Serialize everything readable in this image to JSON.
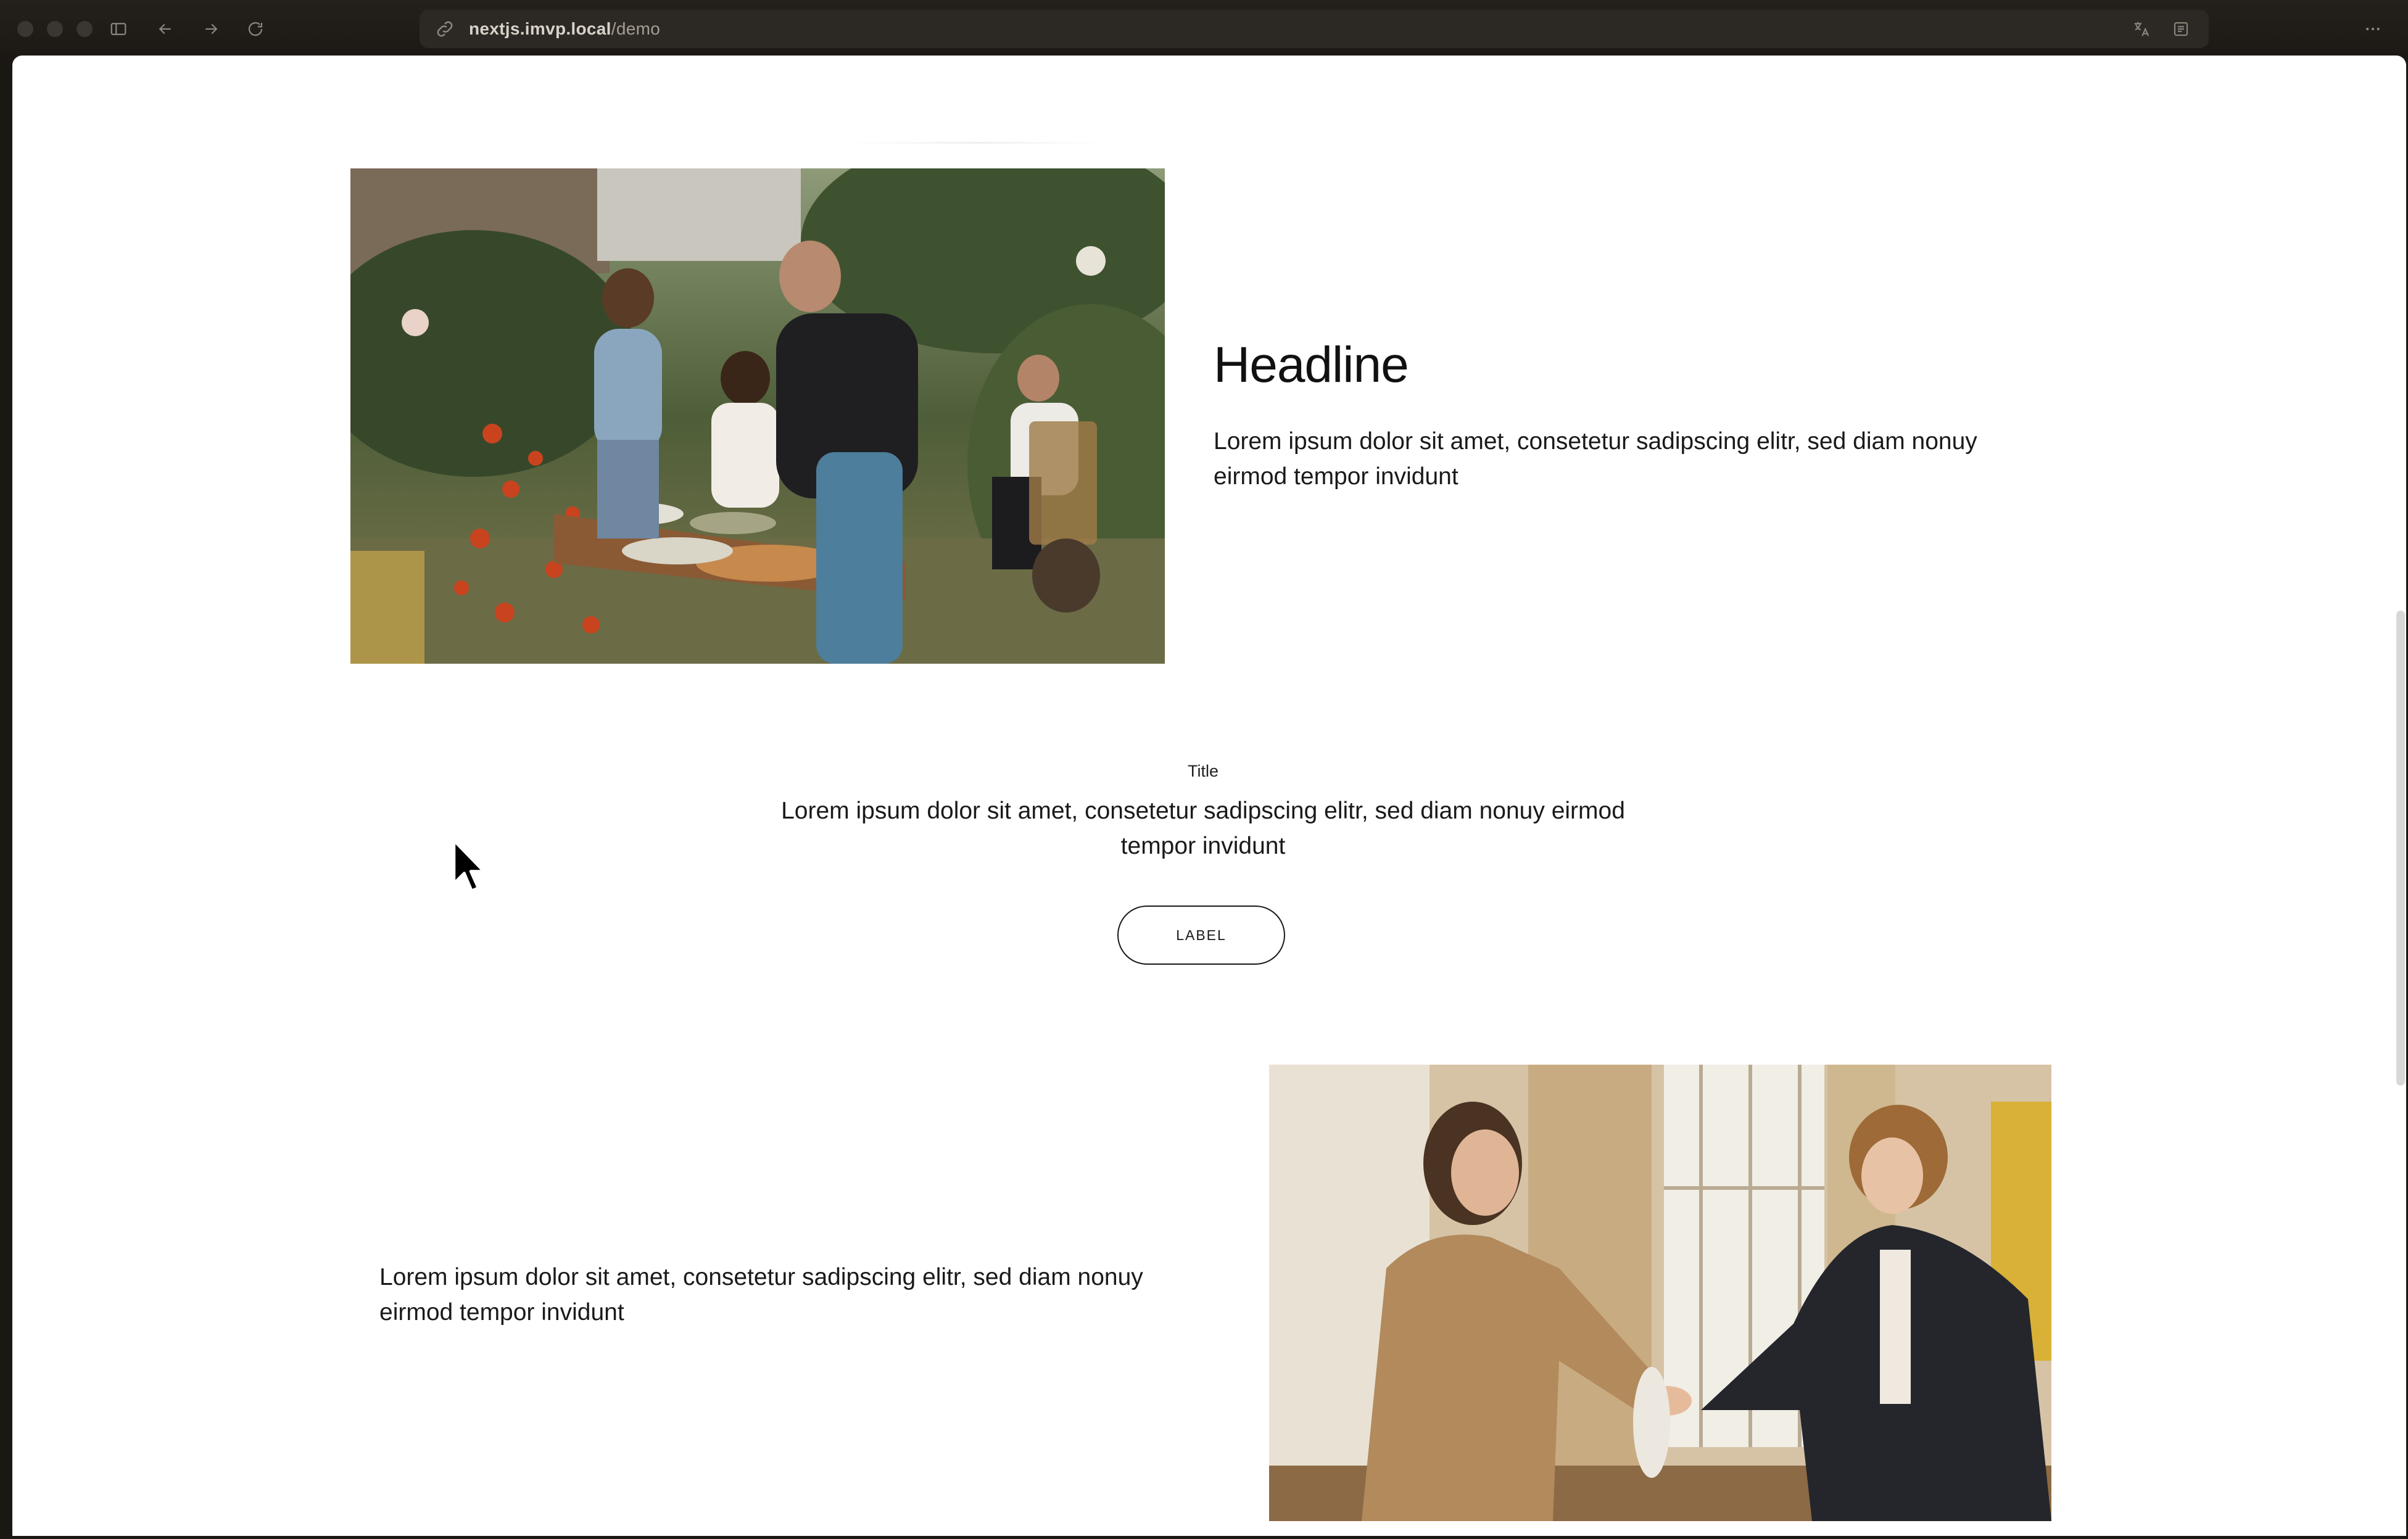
{
  "browser": {
    "url_domain": "nextjs.imvp.local",
    "url_path": "/demo"
  },
  "icons": {
    "sidebar": "sidebar-toggle-icon",
    "back": "arrow-left-icon",
    "forward": "arrow-right-icon",
    "reload": "reload-icon",
    "site": "link-icon",
    "translate": "translate-icon",
    "reader": "reader-icon",
    "more": "more-icon"
  },
  "section1": {
    "headline": "Headline",
    "text": "Lorem ipsum dolor sit amet, consetetur sadipscing elitr, sed diam nonuy eirmod tempor invidunt"
  },
  "section2": {
    "title": "Title",
    "text": "Lorem ipsum dolor sit amet, consetetur sadipscing elitr, sed diam nonuy eirmod tempor invidunt",
    "button_label": "LABEL"
  },
  "section3": {
    "text": "Lorem ipsum dolor sit amet, consetetur sadipscing elitr, sed diam nonuy eirmod tempor invidunt"
  },
  "colors": {
    "chrome_bg": "#1c1814",
    "page_bg": "#ffffff",
    "text": "#1a1a1a"
  }
}
